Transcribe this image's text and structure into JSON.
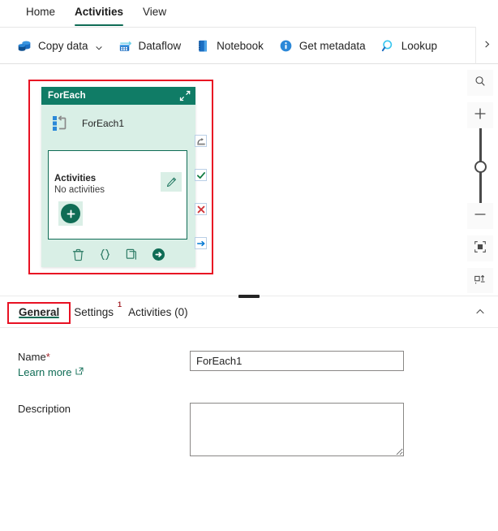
{
  "ribbon": {
    "tabs": [
      {
        "label": "Home",
        "active": false
      },
      {
        "label": "Activities",
        "active": true
      },
      {
        "label": "View",
        "active": false
      }
    ],
    "commands": [
      {
        "label": "Copy data",
        "icon": "copy-data-icon",
        "has_chevron": true
      },
      {
        "label": "Dataflow",
        "icon": "dataflow-icon",
        "has_chevron": false
      },
      {
        "label": "Notebook",
        "icon": "notebook-icon",
        "has_chevron": false
      },
      {
        "label": "Get metadata",
        "icon": "get-metadata-icon",
        "has_chevron": false
      },
      {
        "label": "Lookup",
        "icon": "lookup-icon",
        "has_chevron": false
      }
    ],
    "overflow_icon": "chevron-right-icon"
  },
  "canvas": {
    "node": {
      "header_title": "ForEach",
      "expand_icon": "expand-collapse-icon",
      "activity_icon": "foreach-loop-icon",
      "activity_name": "ForEach1",
      "inner": {
        "title": "Activities",
        "subtitle": "No activities",
        "edit_icon": "pencil-edit-icon",
        "add_icon": "plus-add-activity-icon"
      },
      "actions": [
        {
          "name": "delete-activity-icon"
        },
        {
          "name": "code-view-icon"
        },
        {
          "name": "duplicate-activity-icon"
        },
        {
          "name": "run-activity-icon"
        }
      ],
      "connectors": [
        {
          "name": "on-skip-connector",
          "glyph": "skip"
        },
        {
          "name": "on-success-connector",
          "glyph": "check"
        },
        {
          "name": "on-failure-connector",
          "glyph": "cross"
        },
        {
          "name": "on-completion-connector",
          "glyph": "arrow"
        }
      ]
    },
    "zoom_tools": [
      {
        "name": "search-canvas-button",
        "icon": "search-icon"
      },
      {
        "name": "zoom-in-button",
        "icon": "plus-icon"
      },
      {
        "name": "zoom-slider",
        "icon": "slider-icon"
      },
      {
        "name": "zoom-out-button",
        "icon": "minus-icon"
      },
      {
        "name": "fit-to-screen-button",
        "icon": "fit-to-screen-icon"
      },
      {
        "name": "auto-align-button",
        "icon": "auto-align-icon"
      }
    ]
  },
  "splitter": {
    "name": "panel-resize-handle"
  },
  "properties": {
    "tabs": [
      {
        "label": "General",
        "active": true,
        "badge": ""
      },
      {
        "label": "Settings",
        "active": false,
        "badge": "1"
      },
      {
        "label": "Activities (0)",
        "active": false,
        "badge": ""
      }
    ],
    "collapse_icon": "chevron-up-icon",
    "fields": {
      "name": {
        "label": "Name",
        "required_mark": "*",
        "value": "ForEach1",
        "placeholder": "",
        "learn_more": "Learn more",
        "learn_more_icon": "external-link-icon"
      },
      "description": {
        "label": "Description",
        "value": "",
        "placeholder": ""
      }
    }
  },
  "colors": {
    "brand_green": "#0f6c55",
    "node_header": "#107c66",
    "node_body": "#d9efe6",
    "annotation_red": "#e81123",
    "required_red": "#a4262c",
    "accent_blue": "#0078d4"
  }
}
